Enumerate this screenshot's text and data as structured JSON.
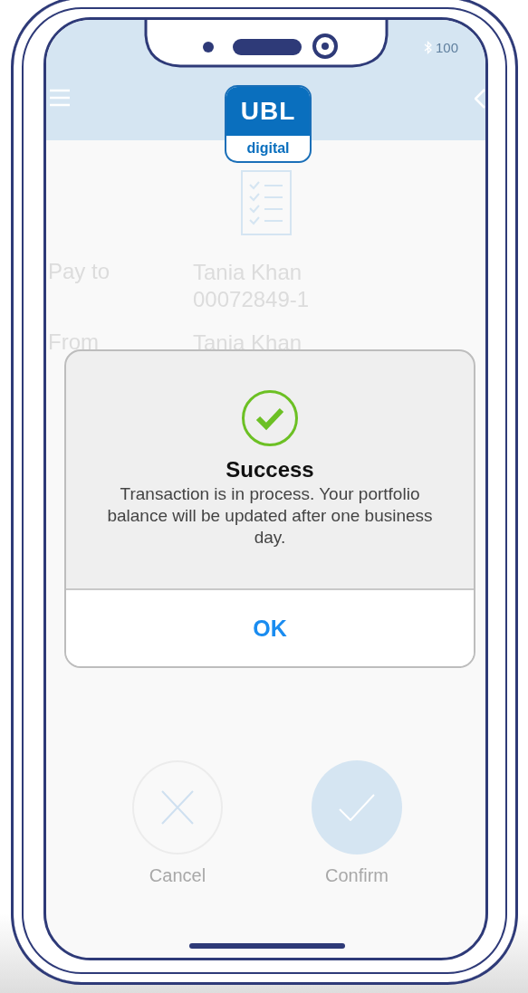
{
  "status_bar": {
    "battery": "100"
  },
  "logo": {
    "name": "UBL",
    "tagline": "digital"
  },
  "details": [
    {
      "label": "Pay to",
      "name": "Tania Khan",
      "account": "00072849-1"
    },
    {
      "label": "From",
      "name": "Tania Khan"
    }
  ],
  "actions": [
    {
      "kind": "cancel",
      "label": "Cancel"
    },
    {
      "kind": "confirm",
      "label": "Confirm"
    }
  ],
  "dialog": {
    "title": "Success",
    "message": "Transaction is in process. Your portfolio balance will be updated after one business day.",
    "button": "OK"
  }
}
